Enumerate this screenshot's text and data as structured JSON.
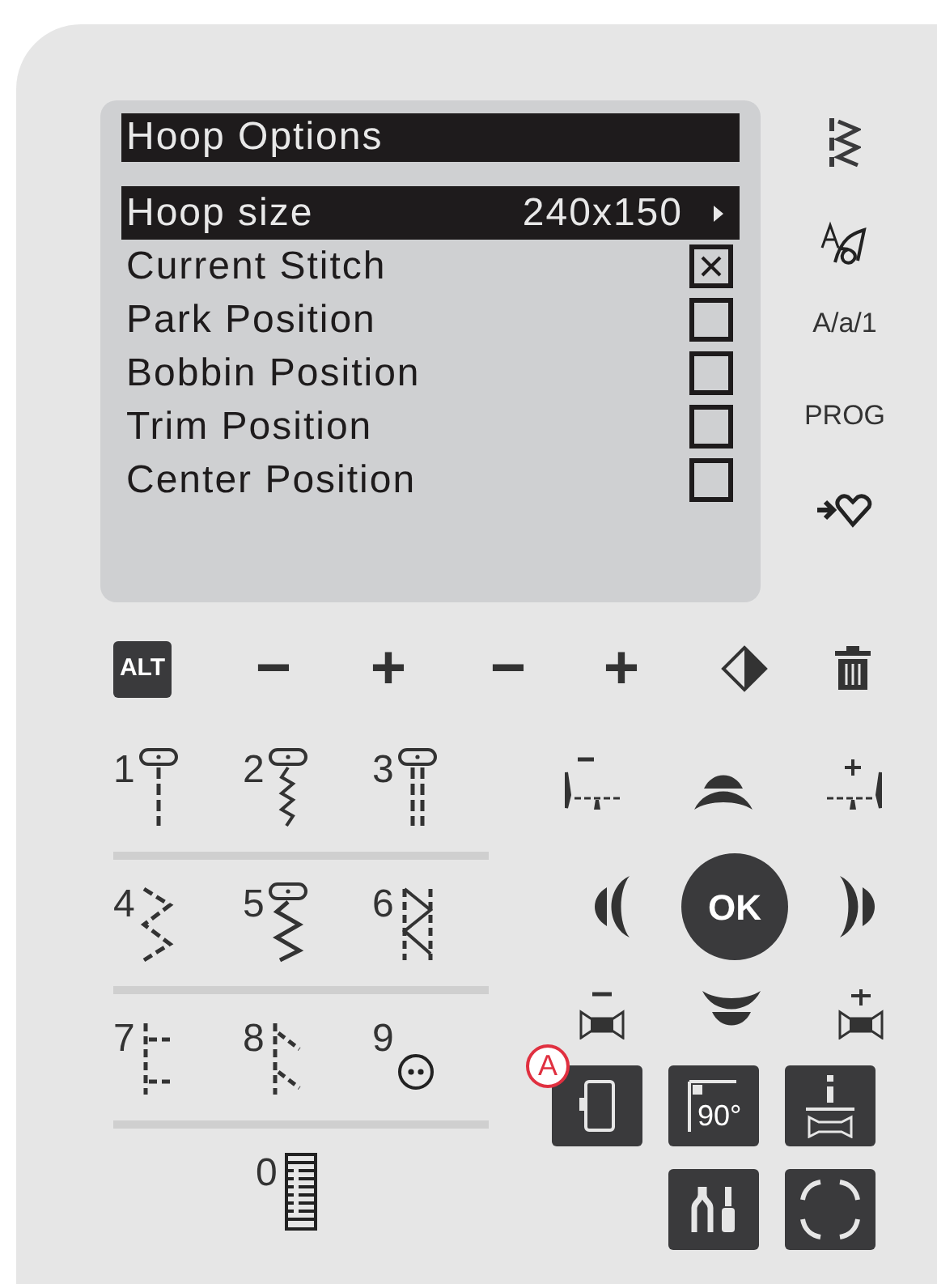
{
  "display": {
    "title": "Hoop Options",
    "rows": [
      {
        "label": "Hoop size",
        "value": "240x150",
        "kind": "submenu",
        "selected": true
      },
      {
        "label": "Current Stitch",
        "kind": "checkbox",
        "checked": true,
        "selected": false
      },
      {
        "label": "Park Position",
        "kind": "checkbox",
        "checked": false,
        "selected": false
      },
      {
        "label": "Bobbin Position",
        "kind": "checkbox",
        "checked": false,
        "selected": false
      },
      {
        "label": "Trim Position",
        "kind": "checkbox",
        "checked": false,
        "selected": false
      },
      {
        "label": "Center Position",
        "kind": "checkbox",
        "checked": false,
        "selected": false
      }
    ]
  },
  "side_buttons": [
    {
      "kind": "stitch"
    },
    {
      "kind": "font"
    },
    {
      "kind": "text",
      "label": "A/a/1"
    },
    {
      "kind": "text",
      "label": "PROG"
    },
    {
      "kind": "heart"
    }
  ],
  "toolbar": [
    {
      "kind": "alt",
      "label": "ALT"
    },
    {
      "kind": "sign",
      "label": "−"
    },
    {
      "kind": "sign",
      "label": "+"
    },
    {
      "kind": "sign",
      "label": "−"
    },
    {
      "kind": "sign",
      "label": "+"
    },
    {
      "kind": "mirror"
    },
    {
      "kind": "trash"
    }
  ],
  "stitch_rows": [
    [
      {
        "number": "1",
        "kind": "straight"
      },
      {
        "number": "2",
        "kind": "stretch"
      },
      {
        "number": "3",
        "kind": "triple"
      }
    ],
    [
      {
        "number": "4",
        "kind": "zigzag"
      },
      {
        "number": "5",
        "kind": "foot-zigzag"
      },
      {
        "number": "6",
        "kind": "overlock"
      }
    ],
    [
      {
        "number": "7",
        "kind": "blind"
      },
      {
        "number": "8",
        "kind": "bias"
      },
      {
        "number": "9",
        "kind": "button"
      }
    ],
    [
      {
        "number": "0",
        "kind": "buttonhole"
      }
    ]
  ],
  "navigation": {
    "ok_label": "OK"
  },
  "function_buttons": [
    {
      "kind": "hoop",
      "callout": "A"
    },
    {
      "kind": "angle",
      "label": "90°"
    },
    {
      "kind": "info"
    },
    {
      "kind": "tools"
    },
    {
      "kind": "corners"
    }
  ]
}
